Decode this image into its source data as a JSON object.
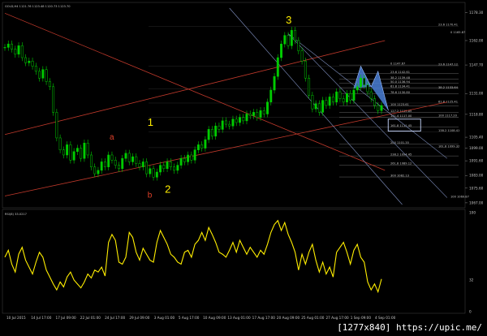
{
  "header": {
    "main_title": "GOLD,H4  1121.76 1123.48 1120.73 1123.70",
    "rsi_title": "RSI(8) 33.0217"
  },
  "watermark": "[1277x840] https://upic.me/",
  "colors": {
    "background": "#000000",
    "candle": "#00cc00",
    "rsi": "#ffee00",
    "channel": "#c0392b",
    "trendline": "#7f8fbf",
    "pattern": "#4a7fd6",
    "fib": "#666666",
    "grid": "#1a1a1a"
  },
  "chart_data": [
    {
      "type": "line",
      "name": "price",
      "title": "GOLD,H4  1121.76 1123.48 1120.73 1123.70",
      "ylim": [
        1066,
        1181
      ],
      "y_ticks": [
        "1178.30",
        "1162.00",
        "1147.70",
        "1131.00",
        "1118.80",
        "1105.40",
        "1099.00",
        "1091.60",
        "1083.00",
        "1075.60",
        "1067.00"
      ],
      "x_ticks": [
        "10 Jul 2015",
        "14 Jul 17:00",
        "17 Jul 09:00",
        "22 Jul 01:00",
        "24 Jul 17:00",
        "29 Jul 09:00",
        "3 Aug 01:00",
        "5 Aug 17:00",
        "10 Aug 09:00",
        "13 Aug 01:00",
        "17 Aug 17:00",
        "20 Aug 09:00",
        "25 Aug 01:00",
        "27 Aug 17:00",
        "1 Sep 09:00",
        "4 Sep 01:00"
      ],
      "close": [
        1158,
        1160,
        1157,
        1154,
        1159,
        1152,
        1149,
        1150,
        1147,
        1144,
        1140,
        1145,
        1138,
        1135,
        1120,
        1105,
        1098,
        1095,
        1101,
        1092,
        1097,
        1099,
        1093,
        1102,
        1095,
        1088,
        1084,
        1086,
        1091,
        1088,
        1095,
        1092,
        1089,
        1087,
        1093,
        1096,
        1091,
        1094,
        1090,
        1088,
        1091,
        1084,
        1087,
        1082,
        1085,
        1089,
        1087,
        1091,
        1088,
        1086,
        1089,
        1093,
        1091,
        1095,
        1092,
        1098,
        1101,
        1099,
        1104,
        1110,
        1106,
        1112,
        1110,
        1115,
        1113,
        1112,
        1116,
        1114,
        1117,
        1115,
        1119,
        1118,
        1120,
        1117,
        1121,
        1119,
        1126,
        1133,
        1141,
        1152,
        1160,
        1165,
        1159,
        1168,
        1162,
        1156,
        1150,
        1140,
        1130,
        1122,
        1125,
        1120,
        1127,
        1124,
        1129,
        1126,
        1132,
        1128,
        1126,
        1131,
        1127,
        1133,
        1135,
        1140,
        1136,
        1132,
        1128,
        1124,
        1121,
        1124
      ],
      "annotations": [
        {
          "text": "3",
          "color": "#ffee00"
        },
        {
          "text": "1",
          "color": "#ffee00"
        },
        {
          "text": "2",
          "color": "#ffee00"
        },
        {
          "text": "a",
          "color": "#e0402a"
        },
        {
          "text": "b",
          "color": "#e0402a"
        }
      ],
      "fib_labels": [
        "0  1147.67",
        "23.6  1142.61",
        "38.2  1139.48",
        "50.0  1136.94",
        "61.8  1134.41",
        "78.6  1130.80",
        "100  1123.61",
        "127.2  1119.85",
        "141.4  1117.00",
        "161.8  1111.45",
        "200  1101.35",
        "238.2  1094.45",
        "261.8  1089.12",
        "300  1082.13"
      ],
      "fib_right_labels": [
        "23.6  1170.41",
        "23.6  1147.12",
        "38.2  1133.64",
        "61.8  1125.41",
        "100  1117.20",
        "138.2  1108.41",
        "161.8  1099.32"
      ],
      "small_fib_labels": [
        "0  1165.87",
        "100  1069.87"
      ]
    },
    {
      "type": "line",
      "name": "rsi",
      "title": "RSI(8) 33.0217",
      "ylim": [
        0,
        100
      ],
      "y_ticks": [
        "100",
        "32",
        "0"
      ],
      "values": [
        55,
        62,
        48,
        40,
        58,
        65,
        52,
        45,
        38,
        50,
        60,
        55,
        42,
        35,
        28,
        22,
        30,
        25,
        35,
        40,
        32,
        28,
        24,
        30,
        38,
        34,
        42,
        40,
        45,
        36,
        70,
        78,
        72,
        50,
        48,
        55,
        80,
        75,
        60,
        52,
        64,
        58,
        52,
        50,
        70,
        82,
        75,
        68,
        58,
        55,
        50,
        48,
        60,
        62,
        55,
        68,
        72,
        80,
        72,
        85,
        78,
        70,
        60,
        58,
        55,
        62,
        70,
        60,
        72,
        65,
        58,
        65,
        60,
        55,
        62,
        58,
        68,
        80,
        88,
        92,
        82,
        90,
        78,
        70,
        60,
        42,
        58,
        48,
        60,
        68,
        52,
        40,
        50,
        38,
        45,
        35,
        60,
        65,
        70,
        60,
        48,
        62,
        68,
        55,
        50,
        30,
        22,
        28,
        20,
        33
      ]
    }
  ]
}
